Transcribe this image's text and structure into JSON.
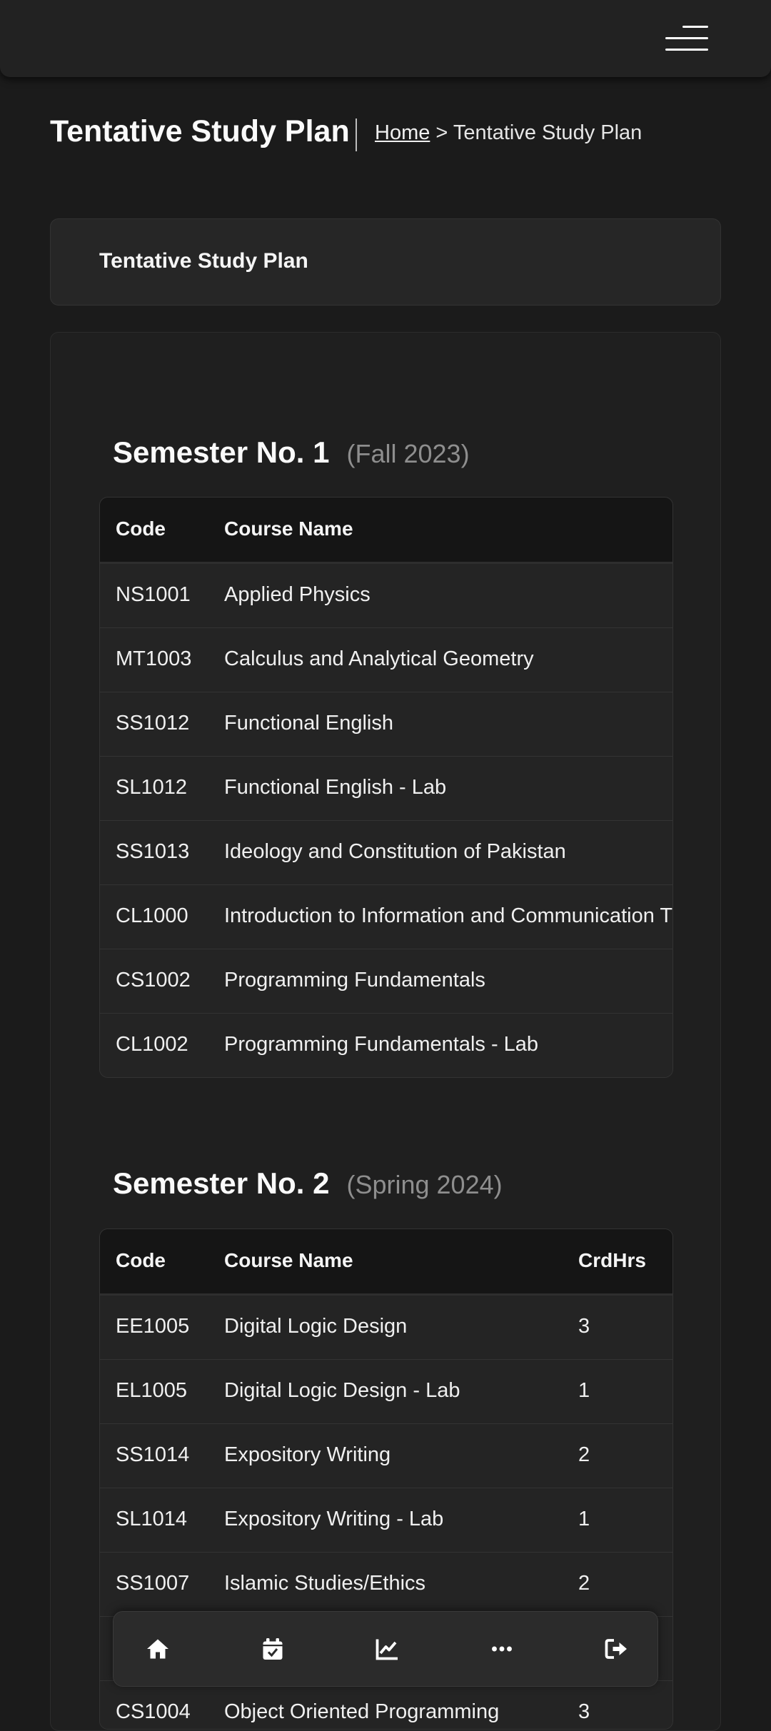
{
  "header": {
    "page_title": "Tentative Study Plan",
    "breadcrumb_home": "Home",
    "breadcrumb_sep": ">",
    "breadcrumb_current": "Tentative Study Plan"
  },
  "card_title": "Tentative Study Plan",
  "table_headers": {
    "code": "Code",
    "name": "Course Name",
    "hours": "CrdHrs"
  },
  "semesters": [
    {
      "title": "Semester No. 1",
      "term": "(Fall 2023)",
      "courses": [
        {
          "code": "NS1001",
          "name": "Applied Physics"
        },
        {
          "code": "MT1003",
          "name": "Calculus and Analytical Geometry"
        },
        {
          "code": "SS1012",
          "name": "Functional English"
        },
        {
          "code": "SL1012",
          "name": "Functional English - Lab"
        },
        {
          "code": "SS1013",
          "name": "Ideology and Constitution of Pakistan"
        },
        {
          "code": "CL1000",
          "name": "Introduction to Information and Communication T"
        },
        {
          "code": "CS1002",
          "name": "Programming Fundamentals"
        },
        {
          "code": "CL1002",
          "name": "Programming Fundamentals - Lab"
        }
      ]
    },
    {
      "title": "Semester No. 2",
      "term": "(Spring 2024)",
      "courses": [
        {
          "code": "EE1005",
          "name": "Digital Logic Design",
          "hours": "3"
        },
        {
          "code": "EL1005",
          "name": "Digital Logic Design - Lab",
          "hours": "1"
        },
        {
          "code": "SS1014",
          "name": "Expository Writing",
          "hours": "2"
        },
        {
          "code": "SL1014",
          "name": "Expository Writing - Lab",
          "hours": "1"
        },
        {
          "code": "SS1007",
          "name": "Islamic Studies/Ethics",
          "hours": "2"
        },
        {
          "code": "",
          "name": "",
          "hours": ""
        },
        {
          "code": "CS1004",
          "name": "Object Oriented Programming",
          "hours": "3"
        }
      ]
    }
  ],
  "bottom_nav": {
    "icons": [
      "home-icon",
      "calendar-check-icon",
      "chart-line-icon",
      "more-icon",
      "sign-out-icon"
    ]
  },
  "colors": {
    "background": "#1b1b1b",
    "surface": "#262626",
    "muted_text": "#8e8e8e"
  }
}
